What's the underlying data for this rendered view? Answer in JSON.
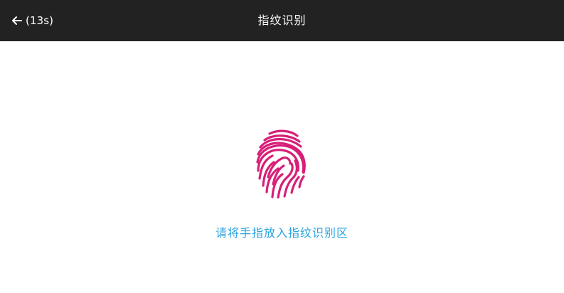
{
  "header": {
    "back_icon": "arrow-left-icon",
    "countdown": "(13s)",
    "title": "指纹识别"
  },
  "main": {
    "fingerprint_icon": "fingerprint-icon",
    "instruction": "请将手指放入指纹识别区"
  },
  "colors": {
    "header_background": "#222222",
    "header_text": "#ffffff",
    "page_background": "#ffffff",
    "fingerprint": "#d81f78",
    "instruction_text": "#2aa3df"
  }
}
